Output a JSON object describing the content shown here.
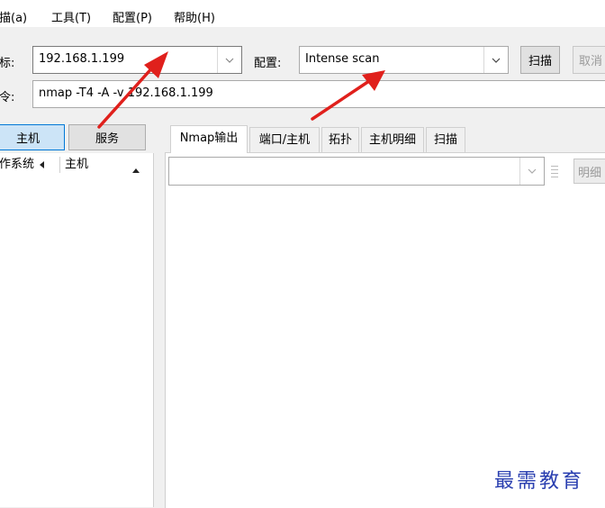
{
  "menu": {
    "scan": "扫描(a)",
    "tools": "工具(T)",
    "profile": "配置(P)",
    "help": "帮助(H)"
  },
  "target": {
    "label": "目标:",
    "value": "192.168.1.199"
  },
  "profile": {
    "label": "配置:",
    "value": "Intense scan"
  },
  "buttons": {
    "scan": "扫描",
    "cancel": "取消",
    "details": "明细"
  },
  "command": {
    "label": "命令:",
    "value": "nmap -T4 -A -v 192.168.1.199"
  },
  "view_toggle": {
    "hosts": "主机",
    "services": "服务"
  },
  "host_list": {
    "col_os": "操作系统",
    "col_host": "主机"
  },
  "tabs": [
    "Nmap输出",
    "端口/主机",
    "拓扑",
    "主机明细",
    "扫描"
  ],
  "watermark": "最需教育",
  "colors": {
    "arrow": "#e0201c",
    "watermark": "#2a3fb0",
    "selected_toggle": "#cce4f7"
  }
}
